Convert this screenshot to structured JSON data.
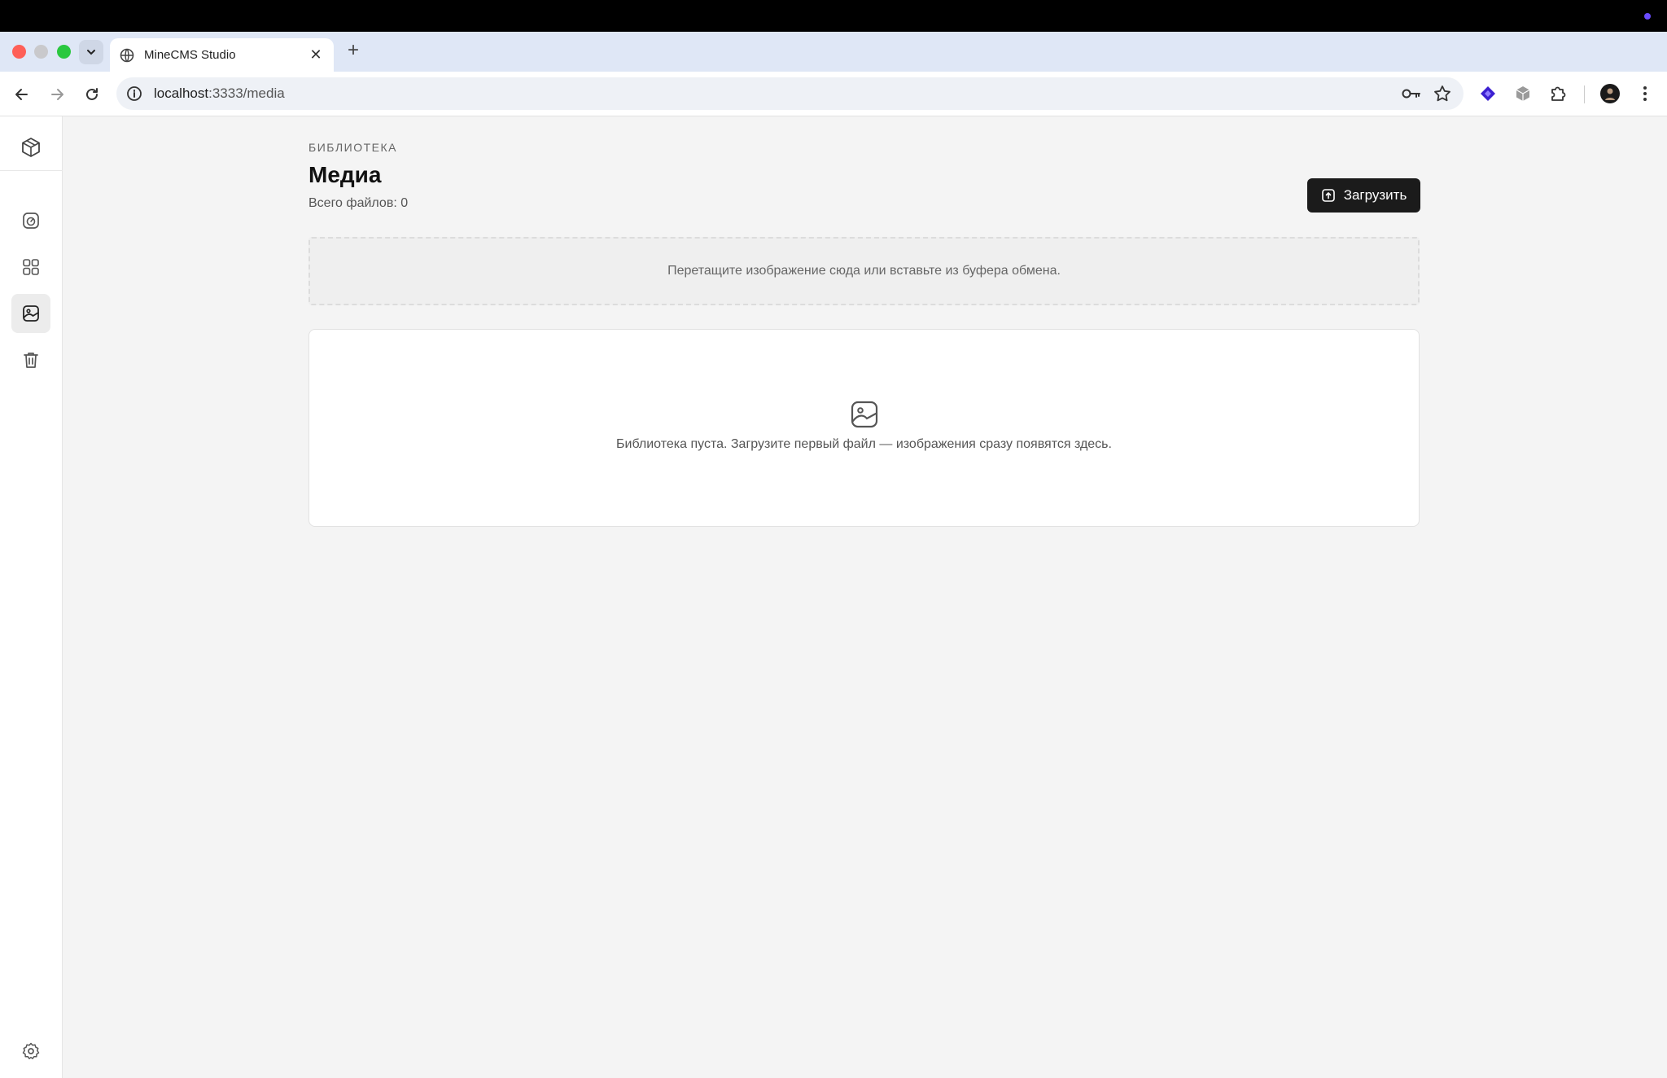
{
  "browser": {
    "tab_title": "MineCMS Studio",
    "url_host": "localhost",
    "url_path": ":3333/media"
  },
  "colors": {
    "primary_button": "#1b1b1b",
    "page_background": "#f4f4f4",
    "sidebar_active": "#ececec"
  },
  "sidebar": {
    "items": [
      {
        "icon": "dashboard-icon",
        "active": false
      },
      {
        "icon": "grid-icon",
        "active": false
      },
      {
        "icon": "image-icon",
        "active": true
      },
      {
        "icon": "trash-icon",
        "active": false
      },
      {
        "icon": "gear-icon",
        "active": false
      }
    ]
  },
  "header": {
    "eyebrow": "БИБЛИОТЕКА",
    "title": "Медиа",
    "count_text": "Всего файлов: 0",
    "upload_label": "Загрузить"
  },
  "dropzone": {
    "text": "Перетащите изображение сюда или вставьте из буфера обмена."
  },
  "empty_state": {
    "icon": "image-icon",
    "text": "Библиотека пуста. Загрузите первый файл — изображения сразу появятся здесь."
  }
}
